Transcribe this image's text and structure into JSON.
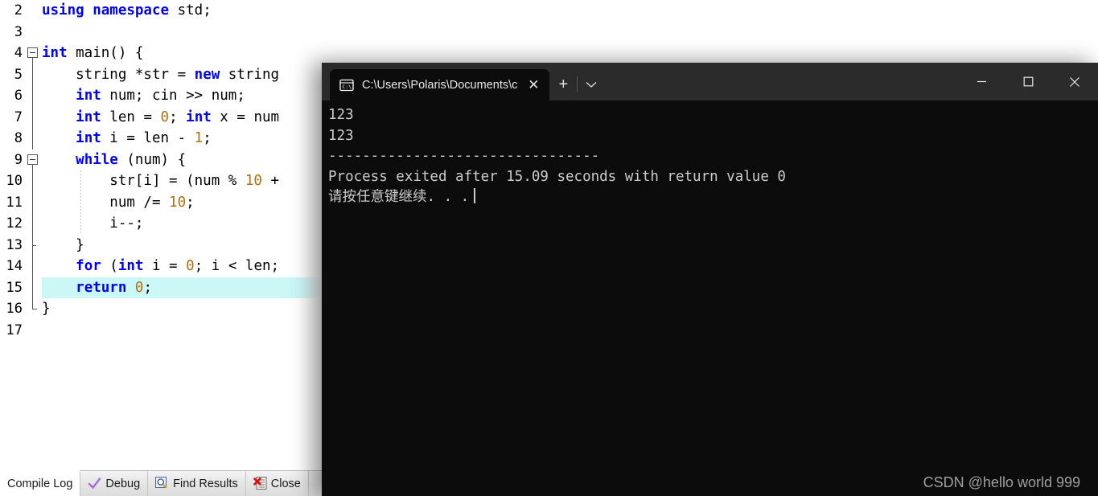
{
  "editor": {
    "name": "Dev-C++ code editor",
    "lines": [
      {
        "num": "2",
        "fold": "none",
        "indent": 0,
        "tokens": [
          {
            "t": "using namespace",
            "c": "kw"
          },
          {
            "t": " std;",
            "c": "plain"
          }
        ]
      },
      {
        "num": "3",
        "fold": "none",
        "indent": 0,
        "tokens": []
      },
      {
        "num": "4",
        "fold": "boxopen",
        "indent": 0,
        "tokens": [
          {
            "t": "int",
            "c": "kw"
          },
          {
            "t": " main() {",
            "c": "plain"
          }
        ]
      },
      {
        "num": "5",
        "fold": "line",
        "indent": 0,
        "tokens": [
          {
            "t": "    string *str = ",
            "c": "plain"
          },
          {
            "t": "new",
            "c": "kw"
          },
          {
            "t": " string",
            "c": "plain"
          }
        ]
      },
      {
        "num": "6",
        "fold": "line",
        "indent": 0,
        "tokens": [
          {
            "t": "    ",
            "c": "plain"
          },
          {
            "t": "int",
            "c": "kw"
          },
          {
            "t": " num; cin >> num;",
            "c": "plain"
          }
        ]
      },
      {
        "num": "7",
        "fold": "line",
        "indent": 0,
        "tokens": [
          {
            "t": "    ",
            "c": "plain"
          },
          {
            "t": "int",
            "c": "kw"
          },
          {
            "t": " len = ",
            "c": "plain"
          },
          {
            "t": "0",
            "c": "num"
          },
          {
            "t": "; ",
            "c": "plain"
          },
          {
            "t": "int",
            "c": "kw"
          },
          {
            "t": " x = num",
            "c": "plain"
          }
        ]
      },
      {
        "num": "8",
        "fold": "line",
        "indent": 0,
        "tokens": [
          {
            "t": "    ",
            "c": "plain"
          },
          {
            "t": "int",
            "c": "kw"
          },
          {
            "t": " i = len - ",
            "c": "plain"
          },
          {
            "t": "1",
            "c": "num"
          },
          {
            "t": ";",
            "c": "plain"
          }
        ]
      },
      {
        "num": "9",
        "fold": "boxopen2",
        "indent": 0,
        "tokens": [
          {
            "t": "    ",
            "c": "plain"
          },
          {
            "t": "while",
            "c": "kw"
          },
          {
            "t": " (num) {",
            "c": "plain"
          }
        ]
      },
      {
        "num": "10",
        "fold": "line",
        "indent": 1,
        "tokens": [
          {
            "t": "        str[i] = (num % ",
            "c": "plain"
          },
          {
            "t": "10",
            "c": "num"
          },
          {
            "t": " +",
            "c": "plain"
          }
        ]
      },
      {
        "num": "11",
        "fold": "line",
        "indent": 1,
        "tokens": [
          {
            "t": "        num /= ",
            "c": "plain"
          },
          {
            "t": "10",
            "c": "num"
          },
          {
            "t": ";",
            "c": "plain"
          }
        ]
      },
      {
        "num": "12",
        "fold": "line",
        "indent": 1,
        "tokens": [
          {
            "t": "        i--;",
            "c": "plain"
          }
        ]
      },
      {
        "num": "13",
        "fold": "tick",
        "indent": 0,
        "tokens": [
          {
            "t": "    }",
            "c": "plain"
          }
        ]
      },
      {
        "num": "14",
        "fold": "line",
        "indent": 0,
        "tokens": [
          {
            "t": "    ",
            "c": "plain"
          },
          {
            "t": "for",
            "c": "kw"
          },
          {
            "t": " (",
            "c": "plain"
          },
          {
            "t": "int",
            "c": "kw"
          },
          {
            "t": " i = ",
            "c": "plain"
          },
          {
            "t": "0",
            "c": "num"
          },
          {
            "t": "; i < len;",
            "c": "plain"
          }
        ]
      },
      {
        "num": "15",
        "fold": "line",
        "indent": 0,
        "highlight": true,
        "tokens": [
          {
            "t": "    ",
            "c": "plain"
          },
          {
            "t": "return",
            "c": "kw"
          },
          {
            "t": " ",
            "c": "plain"
          },
          {
            "t": "0",
            "c": "num"
          },
          {
            "t": ";",
            "c": "plain"
          }
        ]
      },
      {
        "num": "16",
        "fold": "end",
        "indent": 0,
        "tokens": [
          {
            "t": "}",
            "c": "plain"
          }
        ]
      },
      {
        "num": "17",
        "fold": "none",
        "indent": 0,
        "tokens": []
      }
    ],
    "highlight_color": "#ccf7f7",
    "keyword_color": "#0000ff",
    "number_color": "#b07010"
  },
  "bottom_tabs": [
    {
      "label": "Compile Log",
      "icon": "none",
      "active": true
    },
    {
      "label": "Debug",
      "icon": "check-icon",
      "active": false
    },
    {
      "label": "Find Results",
      "icon": "magnifier-icon",
      "active": false
    },
    {
      "label": "Close",
      "icon": "close-red-icon",
      "active": false
    }
  ],
  "terminal": {
    "tab": {
      "icon": "command-prompt-icon",
      "title": "C:\\Users\\Polaris\\Documents\\c",
      "close_label": "✕"
    },
    "new_tab_label": "+",
    "dropdown_label": "⌄",
    "window_controls": {
      "minimize": "—",
      "maximize": "□",
      "close": "✕"
    },
    "background": "#0c0c0c",
    "titlebar_background": "#2b2b2b",
    "output_lines": [
      "123",
      "123",
      "--------------------------------",
      "Process exited after 15.09 seconds with return value 0",
      "请按任意键继续. . ."
    ]
  },
  "watermark": {
    "text": "CSDN @hello world 999"
  }
}
